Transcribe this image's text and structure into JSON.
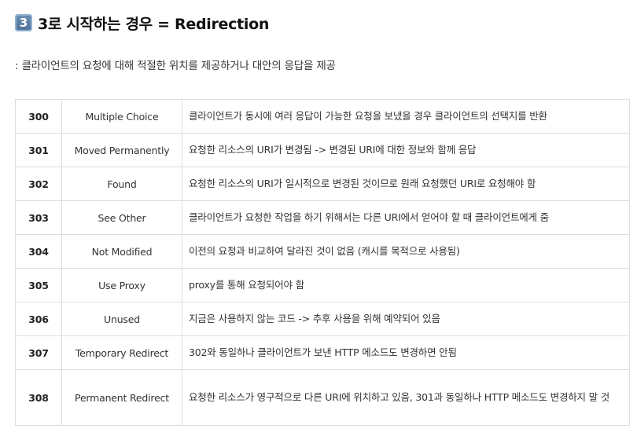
{
  "heading": {
    "badge": "3",
    "text": "3로 시작하는 경우 = Redirection"
  },
  "subtitle": ": 클라이언트의 요청에 대해 적절한 위치를 제공하거나 대안의 응답을 제공",
  "status_table": {
    "rows": [
      {
        "code": "300",
        "name": "Multiple Choice",
        "description": "클라이언트가 동시에 여러 응답이 가능한 요청을 보냈을 경우 클라이언트의 선택지를 반환"
      },
      {
        "code": "301",
        "name": "Moved Permanently",
        "description": "요청한 리소스의 URI가 변경됨 -> 변경된 URI에 대한 정보와 함께 응답"
      },
      {
        "code": "302",
        "name": "Found",
        "description": "요청한 리소스의 URI가 일시적으로 변경된 것이므로 원래 요청했던 URI로 요청해야 함"
      },
      {
        "code": "303",
        "name": "See Other",
        "description": "클라이언트가 요청한 작업을 하기 위해서는 다른 URI에서 얻어야 할 때 클라이언트에게 줌"
      },
      {
        "code": "304",
        "name": "Not Modified",
        "description": "이전의 요청과 비교하여 달라진 것이 없음 (캐시를 목적으로 사용됨)"
      },
      {
        "code": "305",
        "name": "Use Proxy",
        "description": "proxy를 통해 요청되어야 함"
      },
      {
        "code": "306",
        "name": "Unused",
        "description": "지금은 사용하지 않는 코드 -> 추후 사용을 위해 예약되어 있음"
      },
      {
        "code": "307",
        "name": "Temporary Redirect",
        "description": "302와 동일하나 클라이언트가 보낸 HTTP 메소드도 변경하면 안됨"
      },
      {
        "code": "308",
        "name": "Permanent Redirect",
        "description": "요청한 리소스가 영구적으로 다른 URI에 위치하고 있음, 301과 동일하나 HTTP 메소드도 변경하지 말 것"
      }
    ]
  }
}
